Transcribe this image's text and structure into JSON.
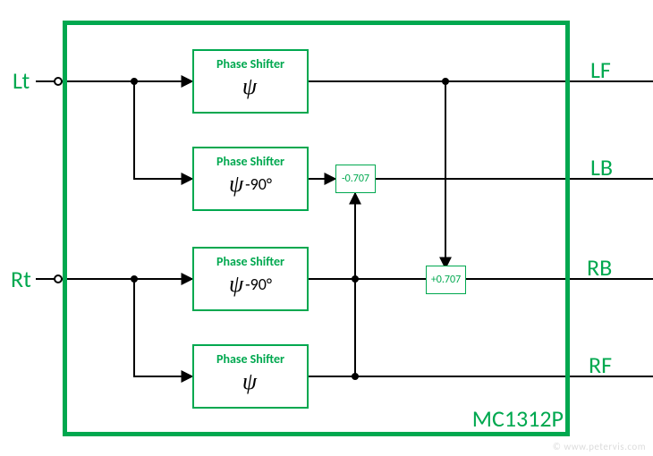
{
  "chip_name": "MC1312P",
  "inputs": {
    "lt": "Lt",
    "rt": "Rt"
  },
  "outputs": {
    "lf": "LF",
    "lb": "LB",
    "rb": "RB",
    "rf": "RF"
  },
  "blocks": {
    "ps1": {
      "title": "Phase Shifter",
      "symbol_psi": "ψ",
      "offset": ""
    },
    "ps2": {
      "title": "Phase Shifter",
      "symbol_psi": "ψ",
      "offset": "-90°"
    },
    "ps3": {
      "title": "Phase Shifter",
      "symbol_psi": "ψ",
      "offset": "-90°"
    },
    "ps4": {
      "title": "Phase Shifter",
      "symbol_psi": "ψ",
      "offset": ""
    }
  },
  "gains": {
    "g_lb": "-0.707",
    "g_rb": "+0.707"
  },
  "colors": {
    "accent": "#00a84f"
  },
  "watermark": "© www.petervis.com"
}
